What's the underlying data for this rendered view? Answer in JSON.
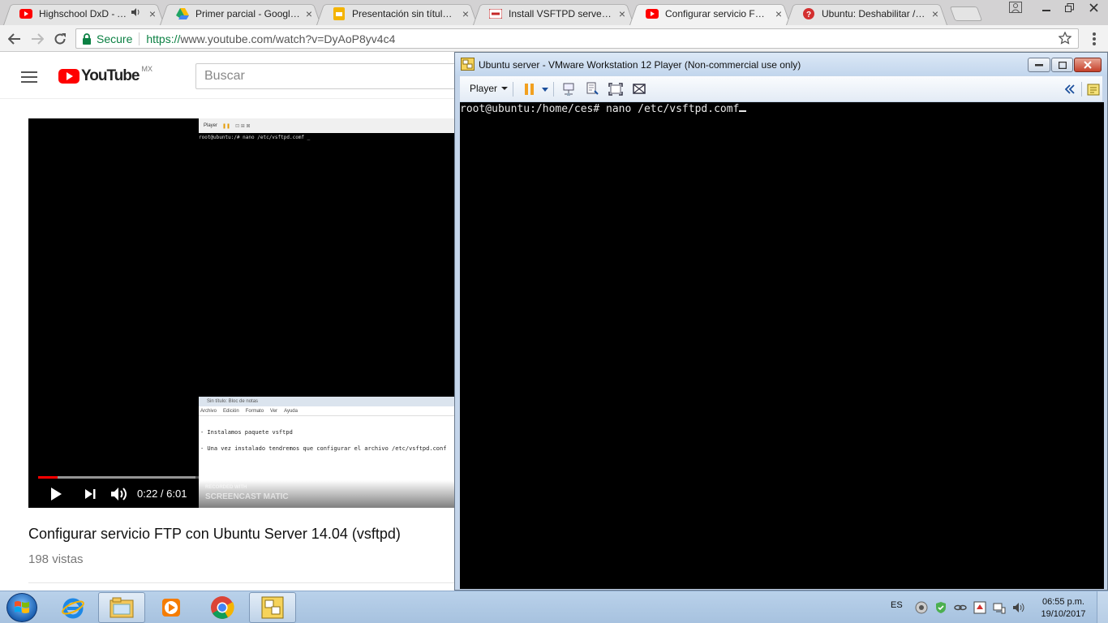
{
  "browser": {
    "tabs": [
      {
        "title": "Highschool DxD - Awe",
        "icon": "youtube-icon",
        "audio": true
      },
      {
        "title": "Primer parcial - Google D",
        "icon": "google-drive-icon"
      },
      {
        "title": "Presentación sin título - E",
        "icon": "google-slides-icon"
      },
      {
        "title": "Install VSFTPD server in U",
        "icon": "site-icon"
      },
      {
        "title": "Configurar servicio FTP c",
        "icon": "youtube-icon",
        "active": true
      },
      {
        "title": "Ubuntu: Deshabilitar / Ha",
        "icon": "question-icon"
      }
    ],
    "tab_close_glyph": "×",
    "secure_label": "Secure",
    "url_scheme": "https://",
    "url_rest": "www.youtube.com/watch?v=DyAoP8yv4c4"
  },
  "youtube": {
    "logo_text": "YouTube",
    "region": "MX",
    "search_placeholder": "Buscar",
    "video_title": "Configurar servicio FTP con Ubuntu Server 14.04 (vsftpd)",
    "views": "198 vistas",
    "player": {
      "time": "0:22 / 6:01",
      "progress": 0.061,
      "buffered": 0.5,
      "inner_toolbar_label": "Player",
      "inner_terminal_line": "root@ubuntu:/# nano /etc/vsftpd.comf _",
      "notepad_title": "Sin título: Bloc de notas",
      "notepad_menu": [
        "Archivo",
        "Edición",
        "Formato",
        "Ver",
        "Ayuda"
      ],
      "notepad_lines": [
        "- Instalamos paquete vsftpd",
        "- Una vez instalado tendremos que configurar el archivo /etc/vsftpd.conf"
      ],
      "watermark_small": "RECORDED WITH",
      "watermark": "SCREENCAST MATIC"
    }
  },
  "vmware": {
    "title": "Ubuntu server - VMware Workstation 12 Player (Non-commercial use only)",
    "player_menu": "Player",
    "terminal_prompt": "root@ubuntu:/home/ces#",
    "terminal_command": " nano /etc/vsftpd.comf"
  },
  "taskbar": {
    "apps": [
      "internet-explorer",
      "file-explorer",
      "media-player",
      "chrome",
      "vmware-player"
    ],
    "language": "ES",
    "time": "06:55 p.m.",
    "date": "19/10/2017"
  },
  "colors": {
    "youtube_red": "#ff0000",
    "secure_green": "#0b8043",
    "terminal_bg": "#000000",
    "vmware_frame": "#c4d5ea",
    "taskbar": "#b9d1ea"
  }
}
